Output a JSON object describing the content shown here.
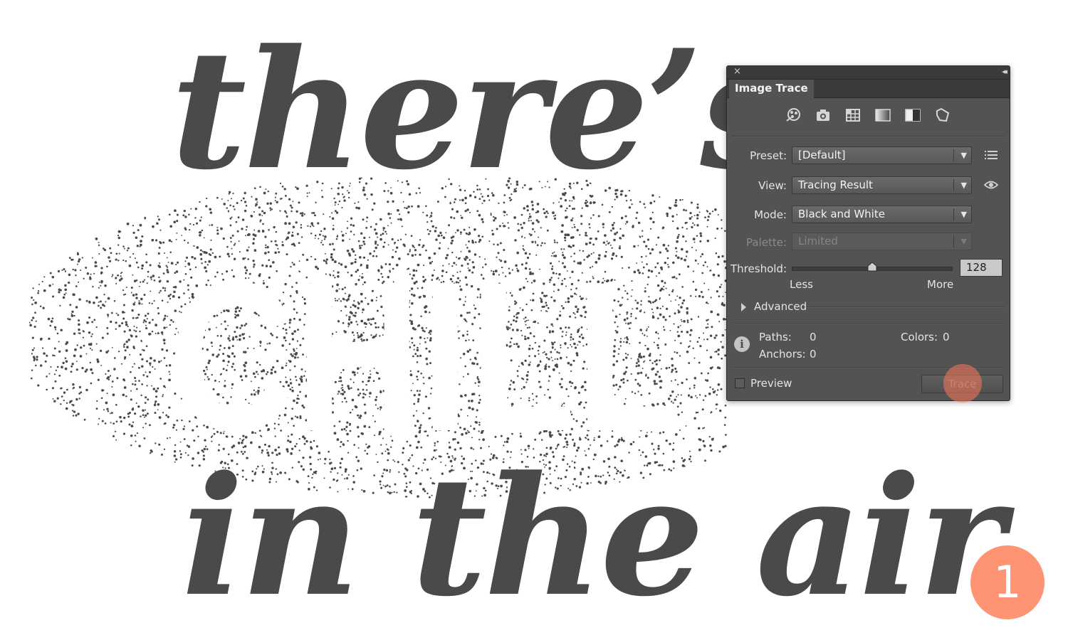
{
  "artwork": {
    "line1": "there’s a",
    "line2": "CHILL",
    "line3": "in the air",
    "ink_color": "#4a4a4a",
    "stipple_color": "#4a4a4a"
  },
  "panel": {
    "title": "Image Trace",
    "close_glyph": "×",
    "collapse_glyph": "◂◂",
    "preset_icons": [
      "auto-color-icon",
      "high-color-icon",
      "low-color-icon",
      "grayscale-icon",
      "black-white-icon",
      "outline-icon"
    ],
    "preset": {
      "label": "Preset:",
      "value": "[Default]"
    },
    "view": {
      "label": "View:",
      "value": "Tracing Result"
    },
    "mode": {
      "label": "Mode:",
      "value": "Black and White"
    },
    "palette": {
      "label": "Palette:",
      "value": "Limited"
    },
    "threshold": {
      "label": "Threshold:",
      "value": "128",
      "min_label": "Less",
      "max_label": "More",
      "fraction": 0.5
    },
    "advanced_label": "Advanced",
    "stats": {
      "paths_label": "Paths:",
      "paths_value": "0",
      "anchors_label": "Anchors:",
      "anchors_value": "0",
      "colors_label": "Colors:",
      "colors_value": "0"
    },
    "info_glyph": "i",
    "preview_label": "Preview",
    "trace_label": "Trace"
  },
  "step_badge": "1",
  "colors": {
    "panel_bg": "#535353",
    "click_highlight": "#ff785a",
    "badge": "#ff9474"
  }
}
